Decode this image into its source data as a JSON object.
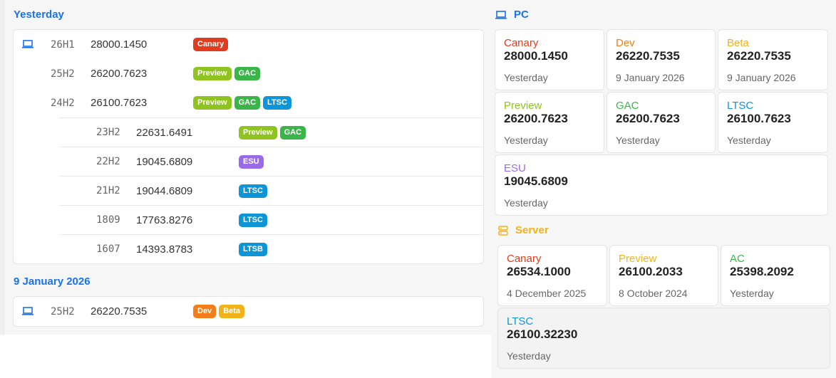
{
  "left": {
    "groups": [
      {
        "title": "Yesterday",
        "rows": [
          {
            "version": "26H1",
            "build": "28000.1450",
            "badges": [
              {
                "label": "Canary",
                "cls": "b-canary"
              }
            ]
          },
          {
            "version": "25H2",
            "build": "26200.7623",
            "badges": [
              {
                "label": "Preview",
                "cls": "b-preview"
              },
              {
                "label": "GAC",
                "cls": "b-gac"
              }
            ]
          },
          {
            "version": "24H2",
            "build": "26100.7623",
            "badges": [
              {
                "label": "Preview",
                "cls": "b-preview"
              },
              {
                "label": "GAC",
                "cls": "b-gac"
              },
              {
                "label": "LTSC",
                "cls": "b-ltsc"
              }
            ]
          },
          {
            "version": "23H2",
            "build": "22631.6491",
            "badges": [
              {
                "label": "Preview",
                "cls": "b-preview"
              },
              {
                "label": "GAC",
                "cls": "b-gac"
              }
            ]
          },
          {
            "version": "22H2",
            "build": "19045.6809",
            "badges": [
              {
                "label": "ESU",
                "cls": "b-esu"
              }
            ]
          },
          {
            "version": "21H2",
            "build": "19044.6809",
            "badges": [
              {
                "label": "LTSC",
                "cls": "b-ltsc"
              }
            ]
          },
          {
            "version": "1809",
            "build": "17763.8276",
            "badges": [
              {
                "label": "LTSC",
                "cls": "b-ltsc"
              }
            ]
          },
          {
            "version": "1607",
            "build": "14393.8783",
            "badges": [
              {
                "label": "LTSB",
                "cls": "b-ltsb"
              }
            ]
          }
        ]
      },
      {
        "title": "9 January 2026",
        "rows": [
          {
            "version": "25H2",
            "build": "26220.7535",
            "badges": [
              {
                "label": "Dev",
                "cls": "b-dev"
              },
              {
                "label": "Beta",
                "cls": "b-beta"
              }
            ]
          }
        ]
      }
    ]
  },
  "pc": {
    "title": "PC",
    "title_color": "#1a73e8",
    "tiles": [
      {
        "channel": "Canary",
        "color": "#e03c1f",
        "build": "28000.1450",
        "date": "Yesterday"
      },
      {
        "channel": "Dev",
        "color": "#f57e18",
        "build": "26220.7535",
        "date": "9 January 2026"
      },
      {
        "channel": "Beta",
        "color": "#f2b31a",
        "build": "26220.7535",
        "date": "9 January 2026"
      },
      {
        "channel": "Preview",
        "color": "#8fc31f",
        "build": "26200.7623",
        "date": "Yesterday"
      },
      {
        "channel": "GAC",
        "color": "#3bb54a",
        "build": "26200.7623",
        "date": "Yesterday"
      },
      {
        "channel": "LTSC",
        "color": "#0d95d8",
        "build": "26100.7623",
        "date": "Yesterday"
      },
      {
        "channel": "ESU",
        "color": "#9a6be6",
        "build": "19045.6809",
        "date": "Yesterday"
      }
    ]
  },
  "server": {
    "title": "Server",
    "title_color": "#f2b31a",
    "tiles": [
      {
        "channel": "Canary",
        "color": "#e03c1f",
        "build": "26534.1000",
        "date": "4 December 2025"
      },
      {
        "channel": "Preview",
        "color": "#f2b31a",
        "build": "26100.2033",
        "date": "8 October 2024"
      },
      {
        "channel": "AC",
        "color": "#3bb54a",
        "build": "25398.2092",
        "date": "Yesterday"
      },
      {
        "channel": "LTSC",
        "color": "#0d95d8",
        "build": "26100.32230",
        "date": "Yesterday"
      }
    ]
  }
}
